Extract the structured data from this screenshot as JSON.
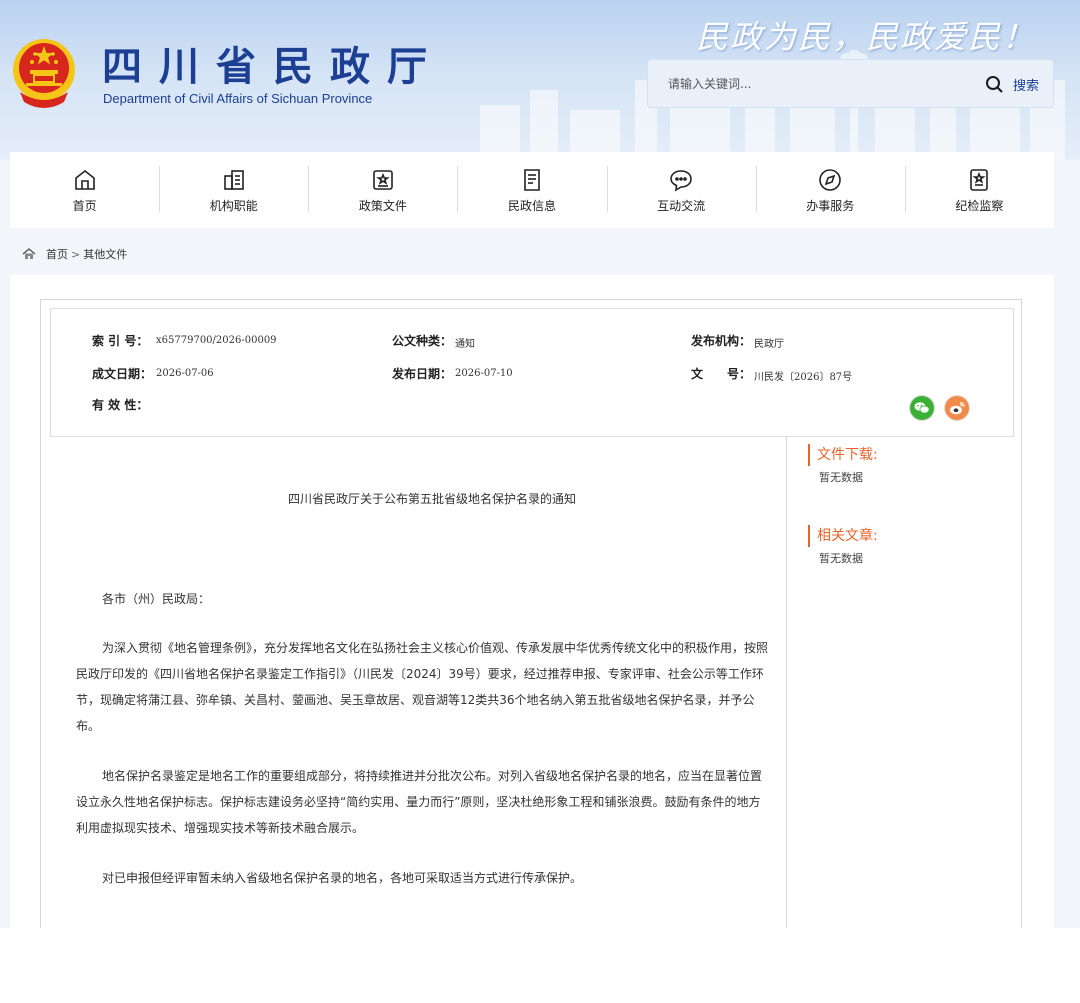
{
  "header": {
    "title": "四川省民政厅",
    "subtitle": "Department of Civil Affairs of Sichuan Province",
    "slogan": "民政为民，民政爱民！",
    "search": {
      "placeholder": "请输入关键词...",
      "button_label": "搜索",
      "icon": "search-icon"
    }
  },
  "nav": [
    {
      "label": "首页",
      "icon": "home-icon"
    },
    {
      "label": "机构职能",
      "icon": "building-icon"
    },
    {
      "label": "政策文件",
      "icon": "policy-doc-icon"
    },
    {
      "label": "民政信息",
      "icon": "news-doc-icon"
    },
    {
      "label": "互动交流",
      "icon": "chat-icon"
    },
    {
      "label": "办事服务",
      "icon": "compass-icon"
    },
    {
      "label": "纪检监察",
      "icon": "badge-doc-icon"
    }
  ],
  "breadcrumb": {
    "home": "首页",
    "separator": ">",
    "current": "其他文件"
  },
  "meta": {
    "index_label": "索 引 号：",
    "index_value": "x65779700/2026-00009",
    "type_label": "公文种类：",
    "type_value": "通知",
    "org_label": "发布机构：",
    "org_value": "民政厅",
    "created_label": "成文日期：",
    "created_value": "2026-07-06",
    "published_label": "发布日期：",
    "published_value": "2026-07-10",
    "docno_label": "文　　号：",
    "docno_value": "川民发〔2026〕87号",
    "validity_label": "有 效 性："
  },
  "share": {
    "wechat_icon": "wechat-icon",
    "weibo_icon": "weibo-icon"
  },
  "article": {
    "title": "四川省民政厅关于公布第五批省级地名保护名录的通知",
    "salutation": "各市（州）民政局：",
    "paragraphs": [
      "为深入贯彻《地名管理条例》，充分发挥地名文化在弘扬社会主义核心价值观、传承发展中华优秀传统文化中的积极作用，按照民政厅印发的《四川省地名保护名录鉴定工作指引》（川民发〔2024〕39号）要求，经过推荐申报、专家评审、社会公示等工作环节，现确定将蒲江县、弥牟镇、关昌村、蓥画池、吴玉章故居、观音湖等12类共36个地名纳入第五批省级地名保护名录，并予公布。",
      "地名保护名录鉴定是地名工作的重要组成部分，将持续推进并分批次公布。对列入省级地名保护名录的地名，应当在显著位置设立永久性地名保护标志。保护标志建设务必坚持“简约实用、量力而行”原则，坚决杜绝形象工程和铺张浪费。鼓励有条件的地方利用虚拟现实技术、增强现实技术等新技术融合展示。",
      "对已申报但经评审暂未纳入省级地名保护名录的地名，各地可采取适当方式进行传承保护。"
    ]
  },
  "sidebar": {
    "downloads_title": "文件下载:",
    "downloads_empty": "暂无数据",
    "related_title": "相关文章:",
    "related_empty": "暂无数据"
  },
  "colors": {
    "brand_blue": "#1c3f94",
    "accent_orange": "#e8642b",
    "emblem_red": "#d7261e",
    "emblem_gold": "#f5c518"
  }
}
